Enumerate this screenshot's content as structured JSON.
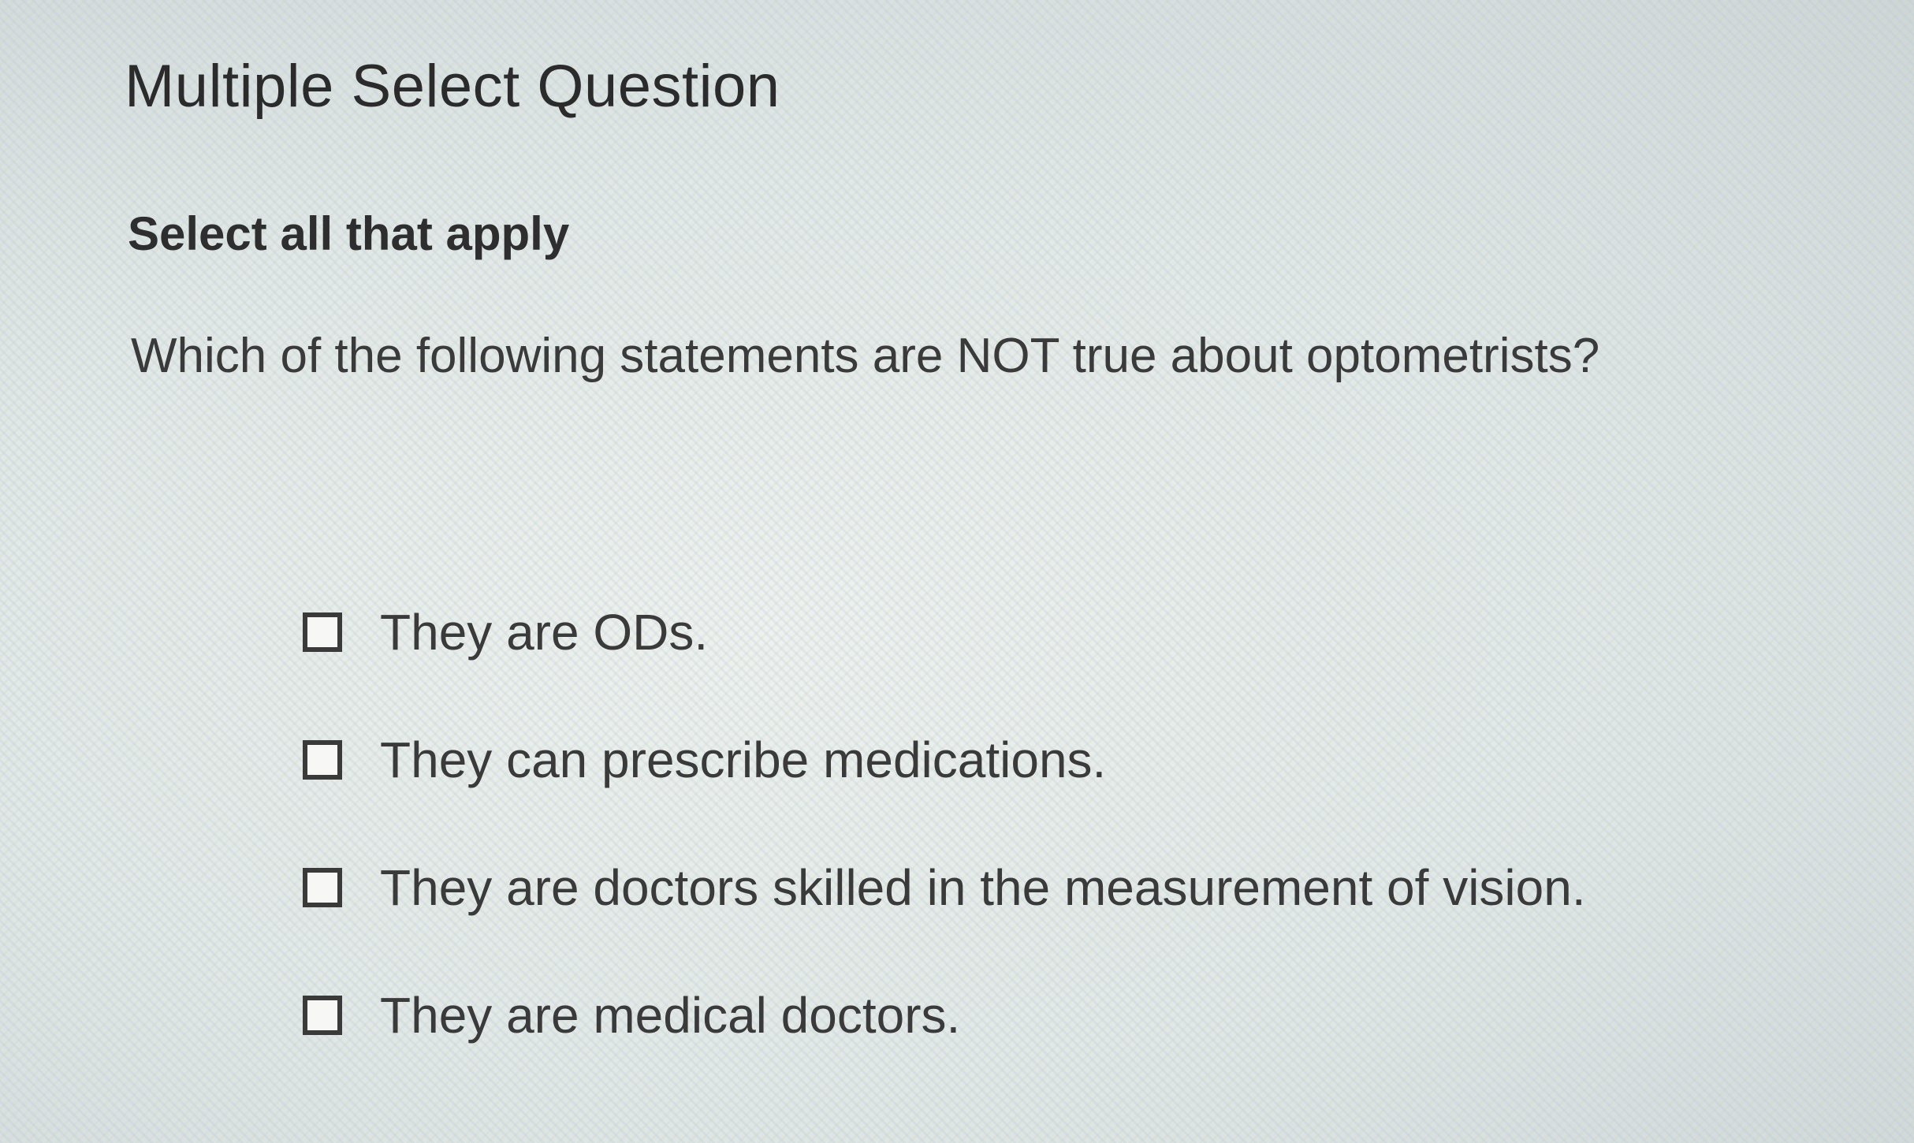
{
  "question": {
    "heading": "Multiple Select Question",
    "instruction": "Select all that apply",
    "prompt": "Which of the following statements are NOT true about optometrists?"
  },
  "options": [
    {
      "label": "They are ODs.",
      "checked": false
    },
    {
      "label": "They can prescribe medications.",
      "checked": false
    },
    {
      "label": "They are doctors skilled in the measurement of vision.",
      "checked": false
    },
    {
      "label": "They are medical doctors.",
      "checked": false
    }
  ]
}
